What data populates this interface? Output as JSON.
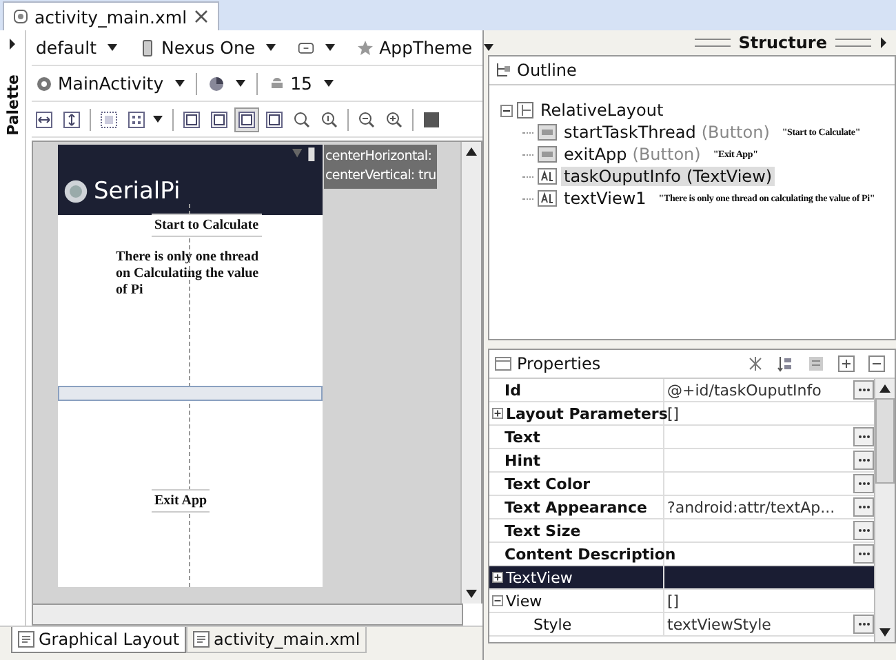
{
  "editor_tab": {
    "title": "activity_main.xml"
  },
  "palette": {
    "label": "Palette"
  },
  "toolbar": {
    "config": "default",
    "device": "Nexus One",
    "theme": "AppTheme",
    "activity": "MainActivity",
    "api": "15",
    "view_toggles": [
      {
        "on": false
      },
      {
        "on": false
      },
      {
        "on": true
      },
      {
        "on": false
      }
    ]
  },
  "canvas": {
    "app_title": "SerialPi",
    "start_button": "Start to Calculate",
    "info_text": "There is only one thread on Calculating the value of Pi",
    "exit_button": "Exit App",
    "hints": [
      "centerHorizontal:",
      "centerVertical: tru"
    ]
  },
  "bottom_tabs": [
    {
      "label": "Graphical Layout",
      "selected": true
    },
    {
      "label": "activity_main.xml",
      "selected": false
    }
  ],
  "structure": {
    "title": "Structure"
  },
  "outline": {
    "title": "Outline",
    "root": {
      "name": "RelativeLayout",
      "expanded": true,
      "children": [
        {
          "kind": "button",
          "name": "startTaskThread",
          "type": "(Button)",
          "note": "\"Start to Calculate\"",
          "selected": false
        },
        {
          "kind": "button",
          "name": "exitApp",
          "type": "(Button)",
          "note": "\"Exit App\"",
          "selected": false
        },
        {
          "kind": "text",
          "name": "taskOuputInfo",
          "type": "(TextView)",
          "selected": true
        },
        {
          "kind": "text",
          "name": "textView1",
          "note": "\"There is only one thread on calculating the value of Pi\"",
          "selected": false
        }
      ]
    }
  },
  "properties": {
    "title": "Properties",
    "rows": [
      {
        "kind": "property",
        "name": "Id",
        "value": "@+id/taskOuputInfo",
        "editor": true,
        "selected": false
      },
      {
        "kind": "group",
        "name": "Layout Parameters",
        "value": "[]",
        "expanded": false,
        "editor": false,
        "selected": false
      },
      {
        "kind": "property",
        "name": "Text",
        "editor": true,
        "selected": false
      },
      {
        "kind": "property",
        "name": "Hint",
        "editor": true,
        "selected": false
      },
      {
        "kind": "property",
        "name": "Text Color",
        "editor": true,
        "selected": false
      },
      {
        "kind": "property",
        "name": "Text Appearance",
        "value": "?android:attr/textAp...",
        "editor": true,
        "selected": false
      },
      {
        "kind": "property",
        "name": "Text Size",
        "editor": true,
        "selected": false
      },
      {
        "kind": "property",
        "name": "Content Description",
        "editor": true,
        "selected": false
      },
      {
        "kind": "category",
        "name": "TextView",
        "expanded": false,
        "editor": false,
        "selected": true
      },
      {
        "kind": "category",
        "name": "View",
        "value": "[]",
        "expanded": true,
        "editor": false,
        "selected": false
      },
      {
        "kind": "sub",
        "name": "Style",
        "value": "textViewStyle",
        "editor": true,
        "selected": false
      }
    ]
  }
}
